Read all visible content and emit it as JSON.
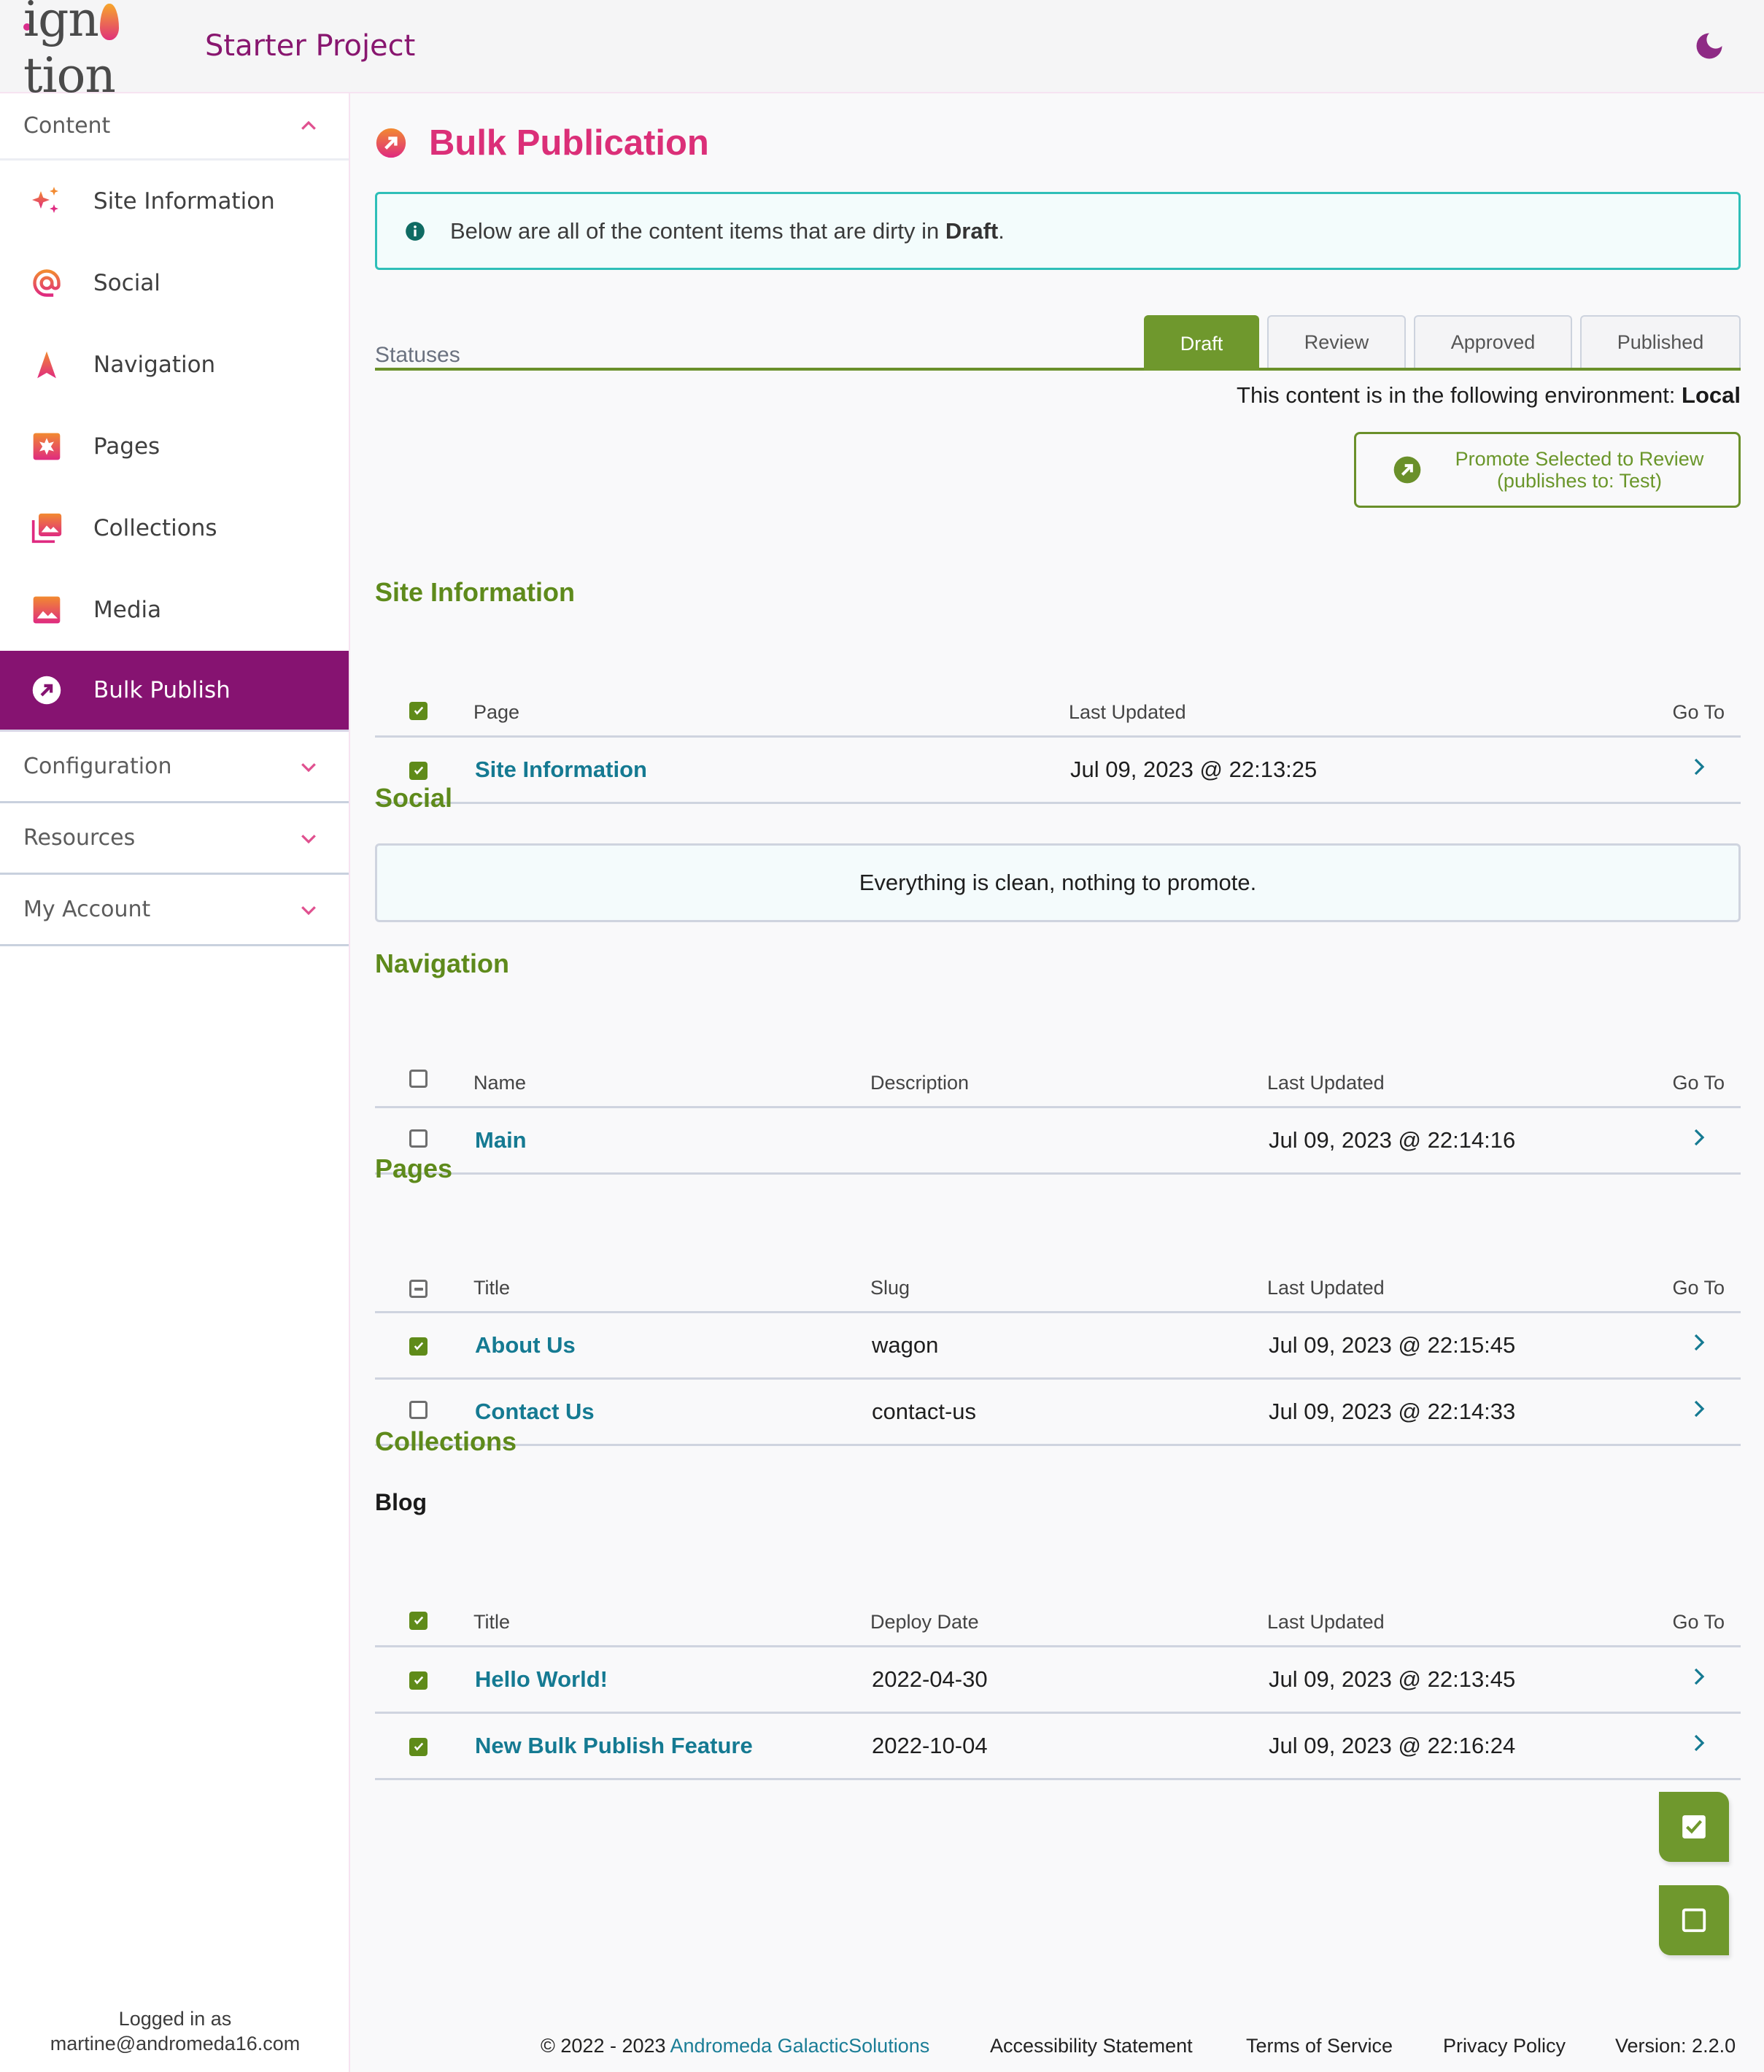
{
  "header": {
    "logo_text": "ignition",
    "project_title": "Starter Project",
    "theme_toggle_icon": "moon-icon"
  },
  "sidebar": {
    "content_group": {
      "label": "Content",
      "expanded": true
    },
    "items": [
      {
        "label": "Site Information",
        "icon": "sparkles-icon"
      },
      {
        "label": "Social",
        "icon": "at-sign-icon"
      },
      {
        "label": "Navigation",
        "icon": "navigation-arrow-icon"
      },
      {
        "label": "Pages",
        "icon": "pages-icon"
      },
      {
        "label": "Collections",
        "icon": "image-stack-icon"
      },
      {
        "label": "Media",
        "icon": "image-icon"
      },
      {
        "label": "Bulk Publish",
        "icon": "arrow-circle-up-right-icon",
        "active": true
      }
    ],
    "groups": [
      {
        "label": "Configuration"
      },
      {
        "label": "Resources"
      },
      {
        "label": "My Account"
      }
    ],
    "logged_in_label": "Logged in as",
    "logged_in_user": "martine@andromeda16.com"
  },
  "page": {
    "title": "Bulk Publication",
    "alert": {
      "prefix": "Below are all of the content items that are dirty in ",
      "emphasis": "Draft",
      "suffix": "."
    },
    "statuses_label": "Statuses",
    "tabs": [
      {
        "label": "Draft",
        "active": true
      },
      {
        "label": "Review"
      },
      {
        "label": "Approved"
      },
      {
        "label": "Published"
      }
    ],
    "environment": {
      "prefix": "This content is in the following environment: ",
      "value": "Local"
    },
    "promote_button": {
      "line1": "Promote Selected to Review",
      "line2": "(publishes to: Test)"
    }
  },
  "sections": {
    "site_information": {
      "heading": "Site Information",
      "columns": [
        "Page",
        "Last Updated",
        "Go To"
      ],
      "header_checkbox": "checked",
      "rows": [
        {
          "checked": true,
          "page": "Site Information",
          "last_updated": "Jul 09, 2023 @ 22:13:25"
        }
      ]
    },
    "social": {
      "heading": "Social",
      "empty_message": "Everything is clean, nothing to promote."
    },
    "navigation": {
      "heading": "Navigation",
      "columns": [
        "Name",
        "Description",
        "Last Updated",
        "Go To"
      ],
      "header_checkbox": "unchecked",
      "rows": [
        {
          "checked": false,
          "name": "Main",
          "description": "",
          "last_updated": "Jul 09, 2023 @ 22:14:16"
        }
      ]
    },
    "pages": {
      "heading": "Pages",
      "columns": [
        "Title",
        "Slug",
        "Last Updated",
        "Go To"
      ],
      "header_checkbox": "indeterminate",
      "rows": [
        {
          "checked": true,
          "title": "About Us",
          "slug": "wagon",
          "last_updated": "Jul 09, 2023 @ 22:15:45"
        },
        {
          "checked": false,
          "title": "Contact Us",
          "slug": "contact-us",
          "last_updated": "Jul 09, 2023 @ 22:14:33"
        }
      ]
    },
    "collections": {
      "heading": "Collections",
      "subheading": "Blog",
      "columns": [
        "Title",
        "Deploy Date",
        "Last Updated",
        "Go To"
      ],
      "header_checkbox": "checked",
      "rows": [
        {
          "checked": true,
          "title": "Hello World!",
          "deploy_date": "2022-04-30",
          "last_updated": "Jul 09, 2023 @ 22:13:45"
        },
        {
          "checked": true,
          "title": "New Bulk Publish Feature",
          "deploy_date": "2022-10-04",
          "last_updated": "Jul 09, 2023 @ 22:16:24"
        }
      ]
    }
  },
  "fabs": {
    "select_all_icon": "checkbox-checked-icon",
    "deselect_all_icon": "checkbox-empty-icon"
  },
  "footer": {
    "copyright": "© 2022 - 2023 ",
    "company_link": "Andromeda GalacticSolutions",
    "links": [
      "Accessibility Statement",
      "Terms of Service",
      "Privacy Policy"
    ],
    "version": "Version: 2.2.0"
  },
  "colors": {
    "brand_purple": "#861371",
    "accent_pink": "#db2f78",
    "green": "#6f982d",
    "link_teal": "#157a92",
    "info_border": "#2ebfb8"
  }
}
